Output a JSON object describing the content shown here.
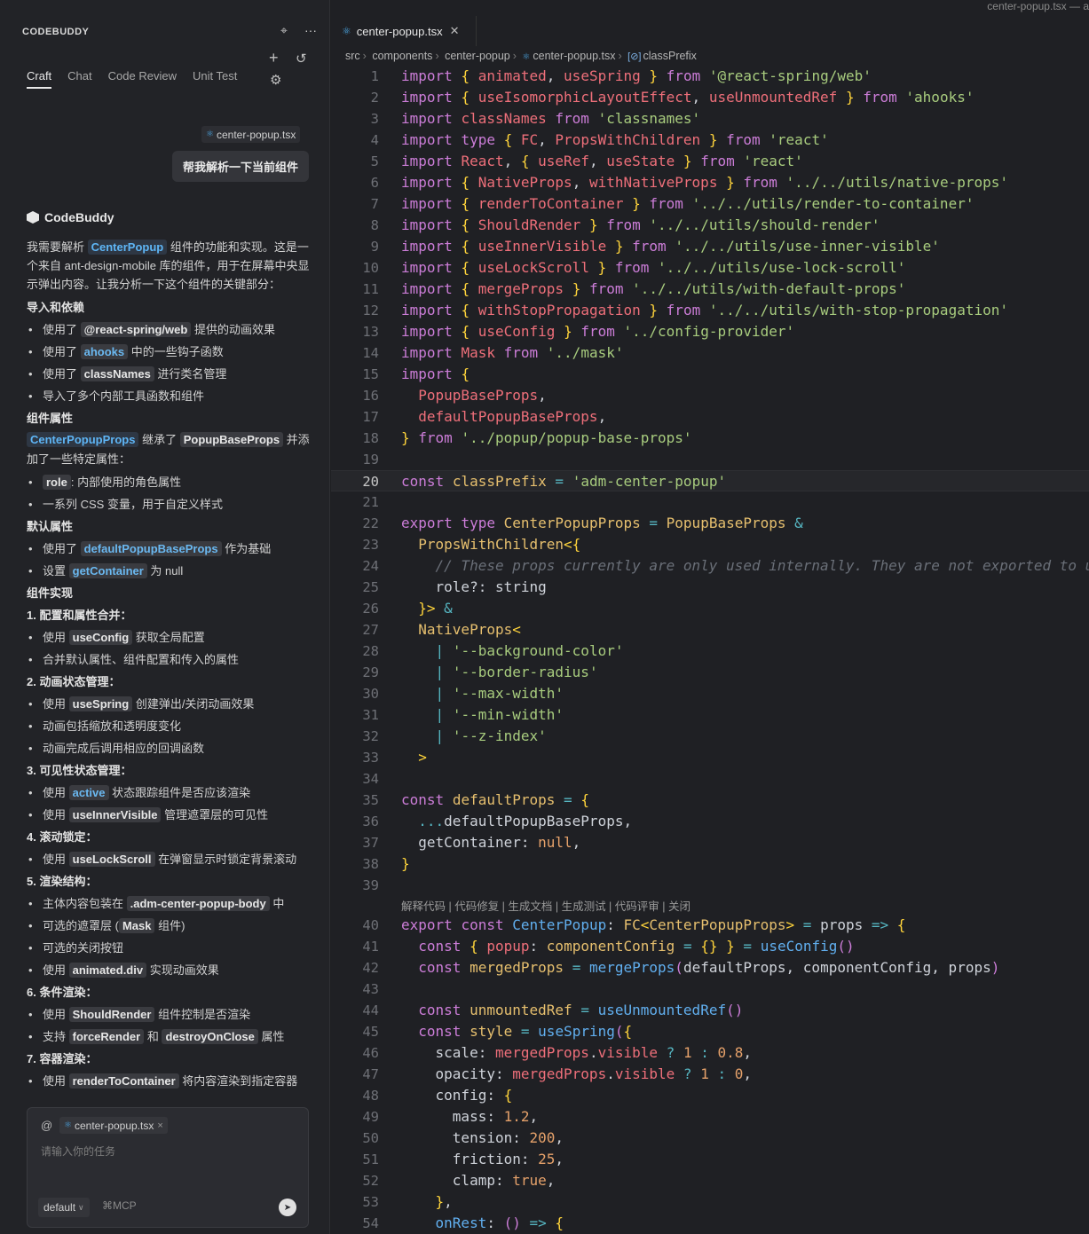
{
  "sidebar": {
    "header": "CODEBUDDY",
    "tabs": [
      "Craft",
      "Chat",
      "Code Review",
      "Unit Test"
    ],
    "active_tab": "Craft",
    "user_file_chip": "center-popup.tsx",
    "user_message": "帮我解析一下当前组件",
    "bot_name": "CodeBuddy",
    "intro_parts": [
      "我需要解析 ",
      "CenterPopup",
      " 组件的功能和实现。这是一个来自 ant-design-mobile 库的组件，用于在屏幕中央显示弹出内容。让我分析一下这个组件的关键部分："
    ],
    "sections": {
      "s1": "导入和依赖",
      "s2": "组件属性",
      "s3": "默认属性",
      "s4": "组件实现"
    },
    "imports": {
      "i1": [
        "使用了 ",
        "@react-spring/web",
        " 提供的动画效果"
      ],
      "i2": [
        "使用了 ",
        "ahooks",
        " 中的一些钩子函数"
      ],
      "i3": [
        "使用了 ",
        "classNames",
        " 进行类名管理"
      ],
      "i4": "导入了多个内部工具函数和组件"
    },
    "props_para": [
      "CenterPopupProps",
      " 继承了 ",
      "PopupBaseProps",
      " 并添加了一些特定属性："
    ],
    "props": {
      "p1": [
        "role",
        ": 内部使用的角色属性"
      ],
      "p2": "一系列 CSS 变量，用于自定义样式"
    },
    "defaults": {
      "d1": [
        "使用了 ",
        "defaultPopupBaseProps",
        " 作为基础"
      ],
      "d2": [
        "设置 ",
        "getContainer",
        " 为 null"
      ]
    },
    "impl": {
      "h1": "1. 配置和属性合并：",
      "a1": [
        "使用 ",
        "useConfig",
        " 获取全局配置"
      ],
      "a2": "合并默认属性、组件配置和传入的属性",
      "h2": "2. 动画状态管理：",
      "b1": [
        "使用 ",
        "useSpring",
        " 创建弹出/关闭动画效果"
      ],
      "b2": "动画包括缩放和透明度变化",
      "b3": "动画完成后调用相应的回调函数",
      "h3": "3. 可见性状态管理：",
      "c1": [
        "使用 ",
        "active",
        " 状态跟踪组件是否应该渲染"
      ],
      "c2": [
        "使用 ",
        "useInnerVisible",
        " 管理遮罩层的可见性"
      ],
      "h4": "4. 滚动锁定：",
      "d1": [
        "使用 ",
        "useLockScroll",
        " 在弹窗显示时锁定背景滚动"
      ],
      "h5": "5. 渲染结构：",
      "e1": [
        "主体内容包装在 ",
        ".adm-center-popup-body",
        " 中"
      ],
      "e2": [
        "可选的遮罩层 (",
        "Mask",
        " 组件)"
      ],
      "e3": "可选的关闭按钮",
      "e4": [
        "使用 ",
        "animated.div",
        " 实现动画效果"
      ],
      "h6": "6. 条件渲染：",
      "f1": [
        "使用 ",
        "ShouldRender",
        " 组件控制是否渲染"
      ],
      "f2": [
        "支持 ",
        "forceRender",
        " 和 ",
        "destroyOnClose",
        " 属性"
      ],
      "h7": "7. 容器渲染：",
      "g1": [
        "使用 ",
        "renderToContainer",
        " 将内容渲染到指定容器"
      ]
    },
    "input": {
      "at": "@",
      "chip": "center-popup.tsx",
      "placeholder": "请输入你的任务",
      "mode": "default",
      "mcp": "MCP"
    }
  },
  "editor": {
    "window_title": "center-popup.tsx — a",
    "tab": "center-popup.tsx",
    "breadcrumb": [
      "src",
      "components",
      "center-popup",
      "center-popup.tsx",
      "classPrefix"
    ],
    "code_lens": "解释代码 | 代码修复 | 生成文档 | 生成测试 | 代码评审 | 关闭",
    "current_line": 20
  }
}
